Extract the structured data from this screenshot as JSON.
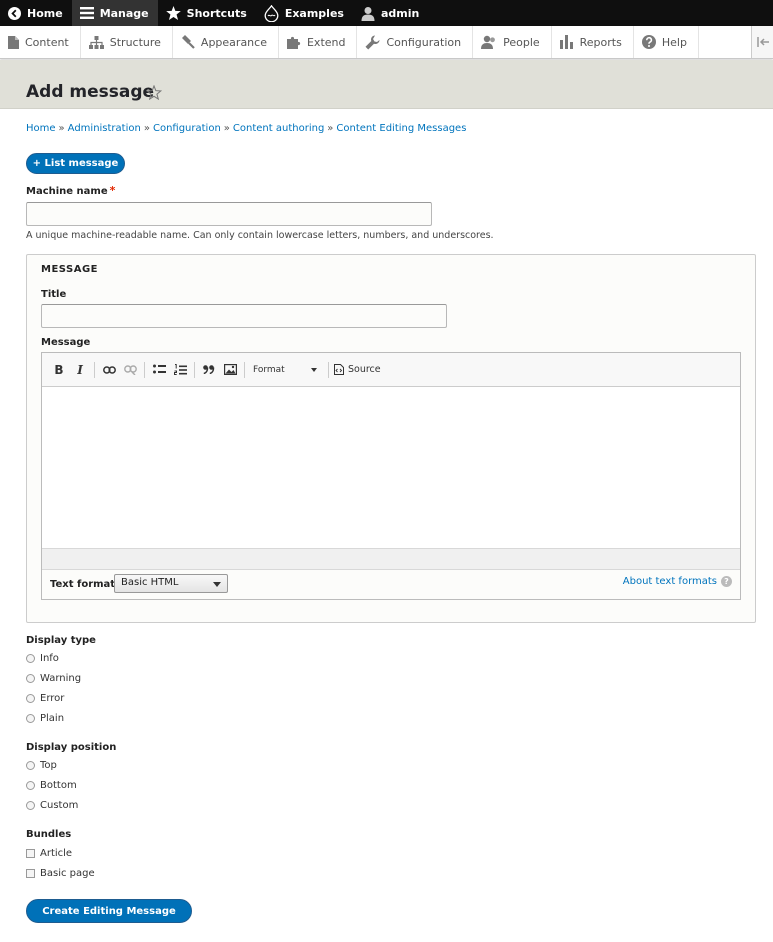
{
  "toolbar": {
    "home": "Home",
    "manage": "Manage",
    "shortcuts": "Shortcuts",
    "examples": "Examples",
    "user": "admin"
  },
  "tray": {
    "items": [
      "Content",
      "Structure",
      "Appearance",
      "Extend",
      "Configuration",
      "People",
      "Reports",
      "Help"
    ]
  },
  "page": {
    "title": "Add message"
  },
  "breadcrumb": [
    "Home",
    "Administration",
    "Configuration",
    "Content authoring",
    "Content Editing Messages"
  ],
  "breadcrumb_sep": "»",
  "actions": {
    "list_message": "+ List message"
  },
  "form": {
    "machine_name_label": "Machine name",
    "required_mark": "*",
    "machine_name_value": "",
    "machine_name_desc": "A unique machine-readable name. Can only contain lowercase letters, numbers, and underscores.",
    "fieldset_legend": "MESSAGE",
    "title_label": "Title",
    "title_value": "",
    "message_label": "Message",
    "editor": {
      "bold": "B",
      "italic": "I",
      "format": "Format",
      "source": "Source"
    },
    "text_format_label": "Text format",
    "text_format_value": "Basic HTML",
    "about_formats": "About text formats",
    "help_glyph": "?",
    "display_type_label": "Display type",
    "display_types": [
      "Info",
      "Warning",
      "Error",
      "Plain"
    ],
    "display_position_label": "Display position",
    "display_positions": [
      "Top",
      "Bottom",
      "Custom"
    ],
    "bundles_label": "Bundles",
    "bundles": [
      "Article",
      "Basic page"
    ],
    "submit": "Create Editing Message"
  },
  "colors": {
    "primary_button": "#0071b8",
    "link": "#0074bd",
    "header_bg": "#e0e0d8",
    "toolbar_bg": "#0f0f0f"
  }
}
